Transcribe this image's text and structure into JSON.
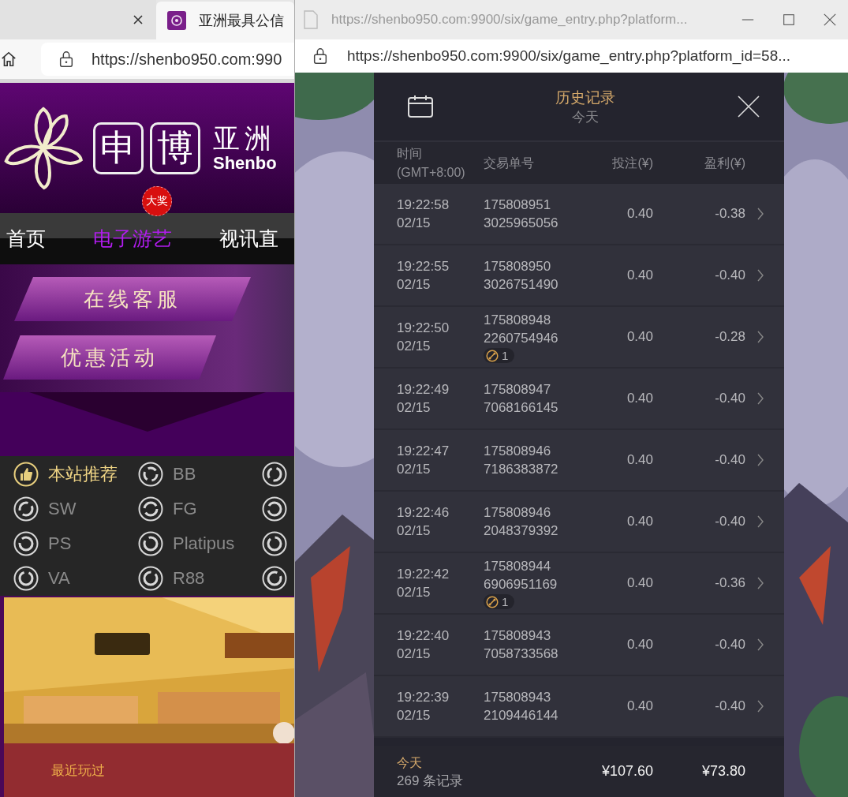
{
  "left_window": {
    "tabs": [
      {
        "selected": false
      },
      {
        "label": "亚洲最具公信",
        "selected": true
      }
    ],
    "address_bar": {
      "url": "https://shenbo950.com:990"
    },
    "site_header": {
      "logo_chars": [
        "申",
        "博"
      ],
      "brand_cn": "亚洲",
      "brand_en": "Shenbo"
    },
    "nav": [
      {
        "label": "首页",
        "selected": false
      },
      {
        "label": "电子游艺",
        "selected": true,
        "badge": "大奖"
      },
      {
        "label": "视讯直",
        "selected": false
      }
    ],
    "promo_buttons": [
      "在线客服",
      "优惠活动"
    ],
    "providers": [
      {
        "label": "本站推荐",
        "selected": true
      },
      {
        "label": "BB",
        "selected": false
      },
      {
        "selected": false
      },
      {
        "label": "SW",
        "selected": false
      },
      {
        "label": "FG",
        "selected": false
      },
      {
        "selected": false
      },
      {
        "label": "PS",
        "selected": false
      },
      {
        "label": "Platipus",
        "selected": false
      },
      {
        "selected": false
      },
      {
        "label": "VA",
        "selected": false
      },
      {
        "label": "R88",
        "selected": false
      },
      {
        "selected": false
      }
    ],
    "bottom_bar": {
      "label": "最近玩过"
    }
  },
  "popup_window": {
    "title": "https://shenbo950.com:9900/six/game_entry.php?platform...",
    "url": "https://shenbo950.com:9900/six/game_entry.php?platform_id=58...",
    "history_panel": {
      "title": "历史记录",
      "subtitle": "今天",
      "columns": [
        "时间\n(GMT+8:00)",
        "交易单号",
        "投注(¥)",
        "盈利(¥)"
      ],
      "rows": [
        {
          "time": "19:22:58",
          "date": "02/15",
          "order": "175808951 3025965056",
          "bet": "0.40",
          "profit": "-0.38"
        },
        {
          "time": "19:22:55",
          "date": "02/15",
          "order": "175808950 3026751490",
          "bet": "0.40",
          "profit": "-0.40"
        },
        {
          "time": "19:22:50",
          "date": "02/15",
          "order": "175808948 2260754946",
          "badge": "1",
          "bet": "0.40",
          "profit": "-0.28"
        },
        {
          "time": "19:22:49",
          "date": "02/15",
          "order": "175808947 7068166145",
          "bet": "0.40",
          "profit": "-0.40"
        },
        {
          "time": "19:22:47",
          "date": "02/15",
          "order": "175808946 7186383872",
          "bet": "0.40",
          "profit": "-0.40"
        },
        {
          "time": "19:22:46",
          "date": "02/15",
          "order": "175808946 2048379392",
          "bet": "0.40",
          "profit": "-0.40"
        },
        {
          "time": "19:22:42",
          "date": "02/15",
          "order": "175808944 6906951169",
          "badge": "1",
          "bet": "0.40",
          "profit": "-0.36"
        },
        {
          "time": "19:22:40",
          "date": "02/15",
          "order": "175808943 7058733568",
          "bet": "0.40",
          "profit": "-0.40"
        },
        {
          "time": "19:22:39",
          "date": "02/15",
          "order": "175808943 2109446144",
          "bet": "0.40",
          "profit": "-0.40"
        }
      ],
      "footer": {
        "period": "今天",
        "count": "269 条记录",
        "total_bet": "¥107.60",
        "total_profit": "¥73.80"
      }
    }
  }
}
